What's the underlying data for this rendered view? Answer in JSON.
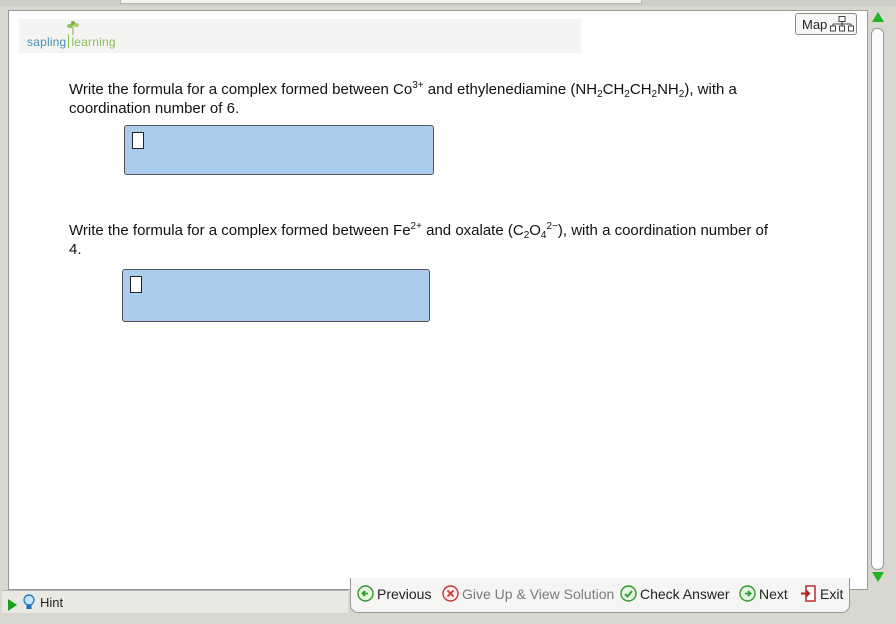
{
  "logo": {
    "word1": "sapling",
    "word2": "learning"
  },
  "map": {
    "label": "Map"
  },
  "questions": [
    {
      "p1": "Write the formula for a complex formed between Co",
      "sup1": "3+",
      "p2": " and ethylenediamine (NH",
      "s1": "2",
      "p3": "CH",
      "s2": "2",
      "p4": "CH",
      "s3": "2",
      "p5": "NH",
      "s4": "2",
      "p6": "), with a coordination number of 6."
    },
    {
      "p1": "Write the formula for a complex formed between Fe",
      "sup1": "2+",
      "p2": " and oxalate (C",
      "s1": "2",
      "p3": "O",
      "s2": "4",
      "sup2": "2−",
      "p4": "), with a coordination number of 4."
    }
  ],
  "footer": {
    "hint": "Hint",
    "previous": "Previous",
    "give_up": "Give Up & View Solution",
    "check": "Check Answer",
    "next": "Next",
    "exit": "Exit"
  },
  "colors": {
    "answer_box": "#acccee",
    "accent_green": "#22b222",
    "logo_blue": "#4a8fb8",
    "logo_green": "#8bbf5a"
  }
}
